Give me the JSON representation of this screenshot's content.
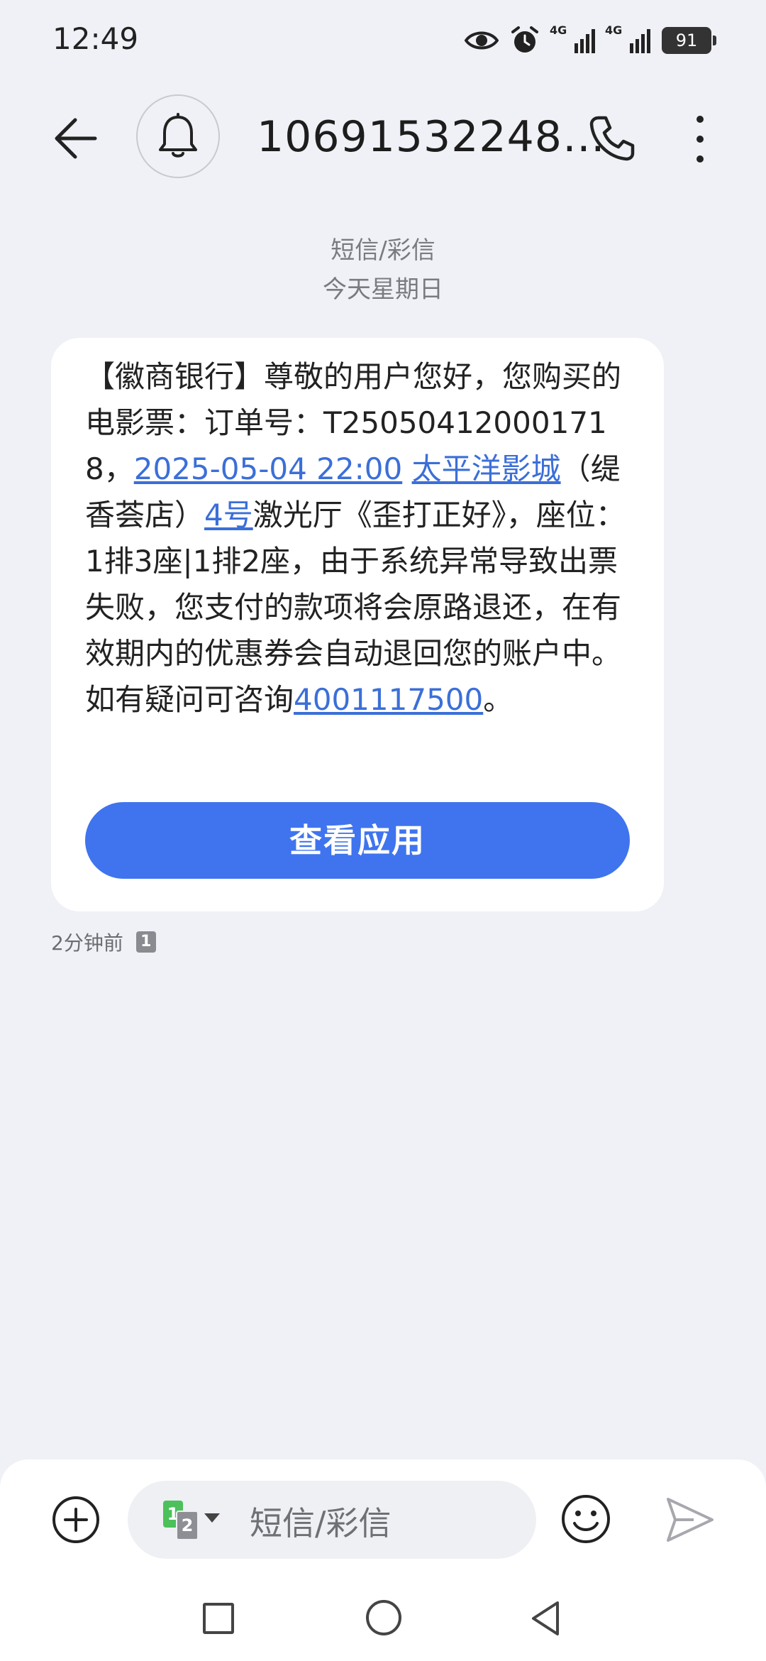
{
  "status_bar": {
    "time": "12:49",
    "network1": "4G",
    "network2": "4G",
    "battery": "91",
    "icons": [
      "eye-icon",
      "alarm-icon",
      "signal-icon",
      "signal-icon",
      "battery-icon"
    ]
  },
  "header": {
    "sender": "10691532248…",
    "icons": [
      "back-arrow-icon",
      "bell-icon",
      "phone-icon",
      "more-vertical-icon"
    ]
  },
  "thread_meta": {
    "type": "短信/彩信",
    "day": "今天星期日"
  },
  "message": {
    "part1": "【徽商银行】尊敬的用户您好，您购买的电影票：订单号：T250504120001718，",
    "link_datetime": "2025-05-04 22:00",
    "link_cinema": "太平洋影城",
    "part2": "（缇香荟店）",
    "link_hall": "4号",
    "part3": "激光厅《歪打正好》，座位：1排3座|1排2座，由于系统异常导致出票失败，您支付的款项将会原路退还，在有效期内的优惠券会自动退回您的账户中。如有疑问可咨询",
    "link_phone": "4001117500",
    "part4": "。",
    "action_button": "查看应用",
    "time_ago": "2分钟前",
    "sim_badge": "1"
  },
  "composer": {
    "sim1": "1",
    "sim2": "2",
    "placeholder": "短信/彩信",
    "icons": [
      "add-icon",
      "emoji-icon",
      "send-icon"
    ]
  },
  "colors": {
    "accent": "#3f74ee",
    "link": "#3b6fd8",
    "background": "#f0f1f6",
    "sim1": "#4cc05a"
  }
}
